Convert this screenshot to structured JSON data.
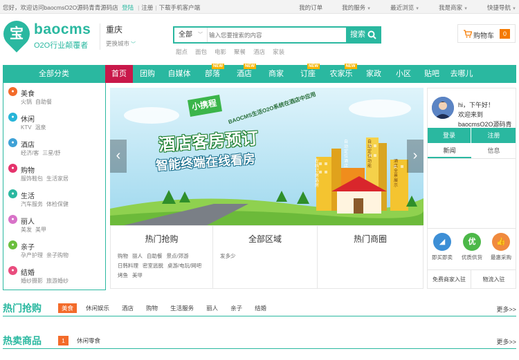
{
  "topbar": {
    "welcome": "您好，欢迎访问baocmsO2O源码青青源码店",
    "login": "登陆",
    "register": "注册",
    "download": "下载手机客户端",
    "links": [
      "我的订单",
      "我的服务",
      "最近浏览",
      "我是商家",
      "快捷导航"
    ]
  },
  "header": {
    "logo_char": "宝",
    "logo_text": "baocms",
    "slogan": "O2O行业颠覆者",
    "city": "重庆",
    "switch_city": "更换城市",
    "search_type": "全部",
    "search_placeholder": "输入您要搜索的内容",
    "search_button": "搜索",
    "hot_words": [
      "甜点",
      "面包",
      "电影",
      "聚餐",
      "酒店",
      "家装"
    ],
    "cart_label": "购物车",
    "cart_count": "0"
  },
  "nav": {
    "all_categories": "全部分类",
    "items": [
      {
        "label": "首页",
        "new": ""
      },
      {
        "label": "团购",
        "new": ""
      },
      {
        "label": "自媒体",
        "new": ""
      },
      {
        "label": "部落",
        "new": "NEW"
      },
      {
        "label": "酒店",
        "new": "NEW"
      },
      {
        "label": "商家",
        "new": ""
      },
      {
        "label": "订座",
        "new": "NEW"
      },
      {
        "label": "农家乐",
        "new": "NEW"
      },
      {
        "label": "家政",
        "new": ""
      },
      {
        "label": "小区",
        "new": ""
      },
      {
        "label": "贴吧",
        "new": ""
      },
      {
        "label": "去哪儿",
        "new": ""
      }
    ]
  },
  "categories": [
    {
      "title": "美食",
      "subs": [
        "火锅",
        "自助餐"
      ],
      "color": "#f36b2a"
    },
    {
      "title": "休闲",
      "subs": [
        "KTV",
        "温泉"
      ],
      "color": "#27b5d9"
    },
    {
      "title": "酒店",
      "subs": [
        "经济/客",
        "三星/舒"
      ],
      "color": "#3ea1d6"
    },
    {
      "title": "购物",
      "subs": [
        "服饰鞋包",
        "生活家居"
      ],
      "color": "#e5336c"
    },
    {
      "title": "生活",
      "subs": [
        "汽车服务",
        "体检保健"
      ],
      "color": "#2ab8a0"
    },
    {
      "title": "丽人",
      "subs": [
        "美发",
        "美甲"
      ],
      "color": "#d872c8"
    },
    {
      "title": "亲子",
      "subs": [
        "孕产护理",
        "亲子购物"
      ],
      "color": "#6bbf3d"
    },
    {
      "title": "结婚",
      "subs": [
        "婚纱摄影",
        "旅游婚纱"
      ],
      "color": "#e94d7e"
    }
  ],
  "banner": {
    "tag": "小携程",
    "subline": "BAOCMS生活O2O系统在酒店中应用",
    "headline": "酒店客房预订",
    "headline2": "智能终端在线看房",
    "labels": [
      "在线订房选房",
      "自动定位功能",
      "酒店全景展示",
      "自动定位酒店"
    ]
  },
  "hot": {
    "col1_title": "热门抢购",
    "col1_items": [
      "购物",
      "丽人",
      "自助餐",
      "景点/郊游",
      "日韩料理",
      "密室逃脱",
      "桌游/电玩/网吧",
      "烤鱼",
      "美甲"
    ],
    "col2_title": "全部区域",
    "col2_items": [
      "发多少"
    ],
    "col3_title": "热门商圈"
  },
  "user": {
    "greeting": "hi，下午好！",
    "welcome": "欢迎来到",
    "site": "baocmsO2O源码青",
    "login": "登录",
    "register": "注册",
    "tabs": [
      "新闻",
      "信息"
    ],
    "icons": [
      {
        "label": "即买即卖",
        "glyph": "◢",
        "color": "#3d8fd6"
      },
      {
        "label": "优质供货",
        "glyph": "优",
        "color": "#4cb848"
      },
      {
        "label": "最惠采购",
        "glyph": "👍",
        "color": "#f08a3e"
      }
    ],
    "links": [
      "免费商家入驻",
      "物流入驻"
    ]
  },
  "sections": {
    "hot_buy": {
      "title": "热门抢购",
      "tabs": [
        "美食",
        "休闲娱乐",
        "酒店",
        "购物",
        "生活服务",
        "丽人",
        "亲子",
        "结婚"
      ],
      "more": "更多>>"
    },
    "hot_goods": {
      "title": "热卖商品",
      "rank": "1",
      "tab": "休闲零食",
      "more": "更多>>"
    }
  }
}
